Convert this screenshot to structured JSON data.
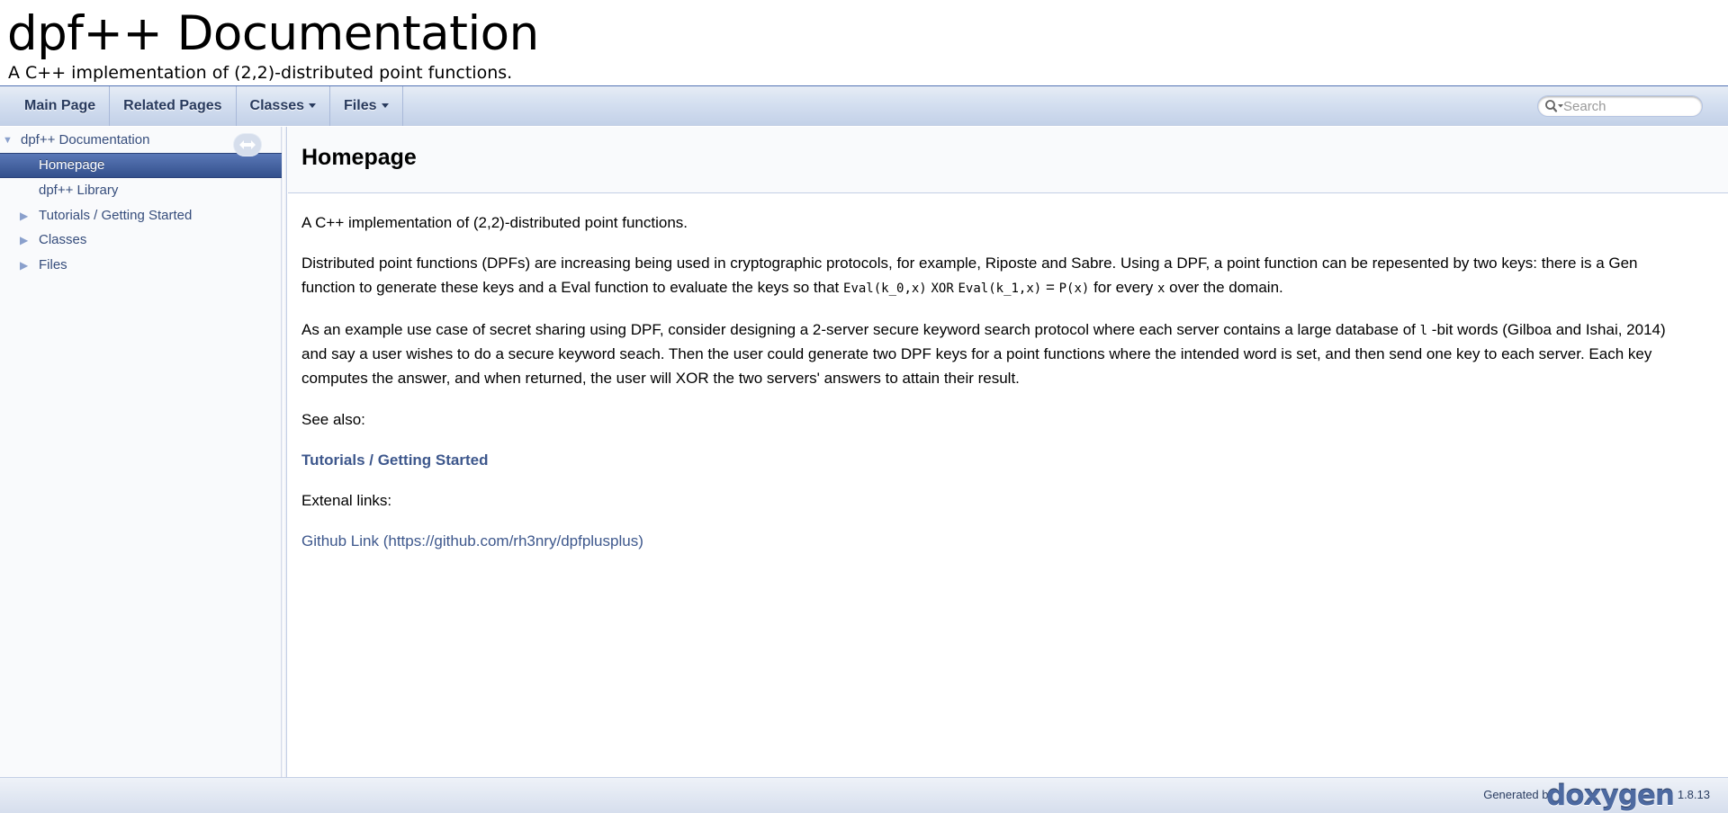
{
  "project": {
    "name": "dpf++ Documentation",
    "brief": "A C++ implementation of (2,2)-distributed point functions."
  },
  "navbar": {
    "items": [
      {
        "label": "Main Page"
      },
      {
        "label": "Related Pages"
      },
      {
        "label": "Classes"
      },
      {
        "label": "Files"
      }
    ],
    "search_placeholder": "Search"
  },
  "sidenav": {
    "root": "dpf++ Documentation",
    "items": [
      {
        "label": "Homepage"
      },
      {
        "label": "dpf++ Library"
      },
      {
        "label": "Tutorials / Getting Started"
      },
      {
        "label": "Classes"
      },
      {
        "label": "Files"
      }
    ]
  },
  "page": {
    "title": "Homepage",
    "intro": "A C++ implementation of (2,2)-distributed point functions.",
    "p2": {
      "line1": "Distributed point functions (DPFs) are increasing being used in cryptographic protocols, for example, Riposte and Sabre. Using a DPF, a point function can be repesented by two keys: there is a Gen",
      "line2_pre": "function to generate these keys and a Eval function to evaluate the keys so that",
      "code1": "Eval(k_0,x)",
      "xor": "XOR",
      "code2": "Eval(k_1,x)",
      "eq": "=",
      "code3": "P(x)",
      "for_every": "for every",
      "code4": "x",
      "line2_post": "over the domain."
    },
    "p3": {
      "line1_pre": "As an example use case of secret sharing using DPF, consider designing a 2-server secure keyword search protocol where each server contains a large database of",
      "code": "l",
      "line1_post": "-bit words (Gilboa and Ishai, 2014)",
      "line2": "and say a user wishes to do a secure keyword seach. Then the user could generate two DPF keys for a point functions where the intended word is set, and then send one key to each server. Each key",
      "line3": "computes the answer, and when returned, the user will XOR the two servers' answers to attain their result."
    },
    "see_also": "See also:",
    "tutorials_link": "Tutorials / Getting Started",
    "external_links": "Extenal links:",
    "github_link": "Github Link (https://github.com/rh3nry/dpfplusplus)"
  },
  "footer": {
    "generated_by": "Generated by",
    "logo": "doxygen",
    "version": "1.8.13"
  },
  "colors": {
    "link": "#3D578C",
    "nav_text": "#283A5D",
    "selected_bg": "#3f5c99"
  }
}
